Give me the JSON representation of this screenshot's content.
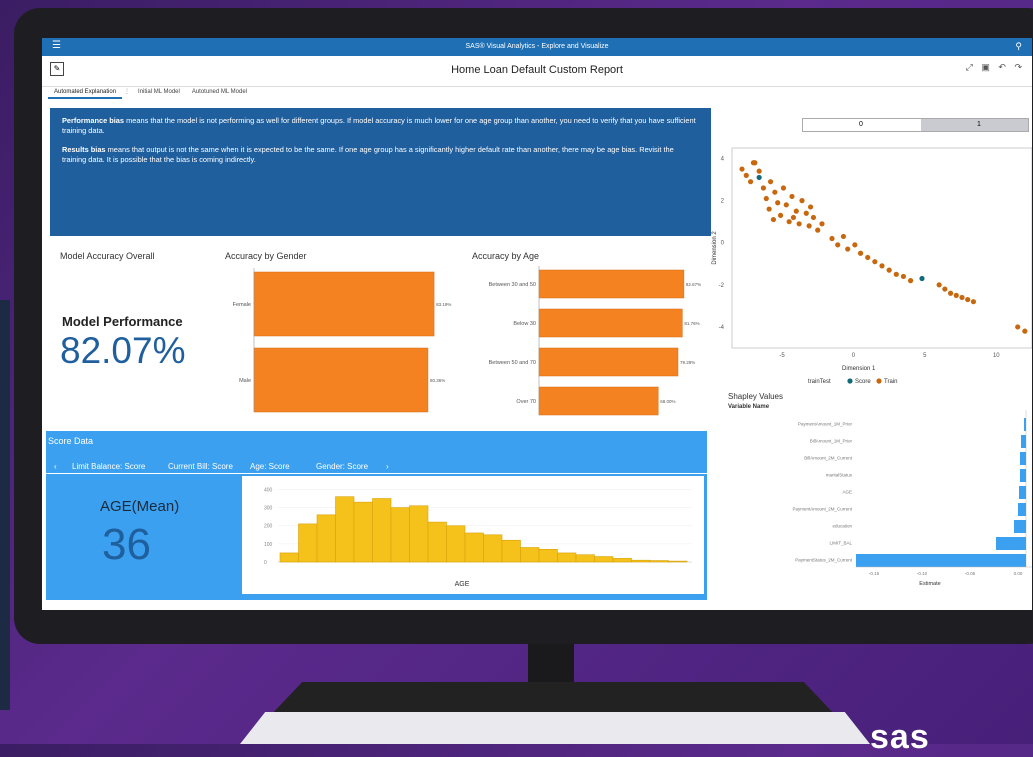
{
  "app": {
    "title": "SAS® Visual Analytics - Explore and Visualize"
  },
  "report": {
    "title": "Home Loan Default Custom Report"
  },
  "tabs": [
    "Automated Explanation",
    "Initial ML Model",
    "Autotuned ML Model"
  ],
  "explanation": {
    "p1_bold": "Performance bias",
    "p1_text": " means that the model is not performing as well for different groups. If model accuracy is much lower for one age group than another, you need to verify that you have sufficient training data.",
    "p2_bold": "Results bias",
    "p2_text": " means that output is not the same when it is expected to be the same.  If one age group has a significantly higher default rate than another, there may be age bias. Revisit the training data. It is possible that the bias is coming indirectly."
  },
  "overall": {
    "title": "Model Accuracy Overall",
    "label": "Model Performance",
    "value": "82.07%"
  },
  "gender_chart": {
    "title": "Accuracy by Gender",
    "categories": [
      "Female",
      "Male"
    ],
    "values": [
      83.19,
      80.36
    ],
    "labels": [
      "83.19%",
      "80.36%"
    ]
  },
  "age_chart": {
    "title": "Accuracy by Age",
    "categories": [
      "Between 30 and 50",
      "Below 30",
      "Between 50 and 70",
      "Over 70"
    ],
    "values": [
      82.67,
      81.76,
      79.28,
      68.0
    ],
    "labels": [
      "82.67%",
      "81.76%",
      "79.28%",
      "68.00%"
    ]
  },
  "score": {
    "header": "Score Data",
    "tabs": [
      "Limit Balance: Score",
      "Current Bill: Score",
      "Age: Score",
      "Gender: Score"
    ],
    "active_tab": 2,
    "age_label": "AGE(Mean)",
    "age_value": "36",
    "hist_xlabel": "AGE"
  },
  "toggle": {
    "left": "0",
    "right": "1"
  },
  "chart_data": [
    {
      "type": "bar",
      "title": "Accuracy by Gender",
      "categories": [
        "Female",
        "Male"
      ],
      "values": [
        83.19,
        80.36
      ]
    },
    {
      "type": "bar",
      "title": "Accuracy by Age",
      "categories": [
        "Between 30 and 50",
        "Below 30",
        "Between 50 and 70",
        "Over 70"
      ],
      "values": [
        82.67,
        81.76,
        79.28,
        68.0
      ]
    },
    {
      "type": "bar",
      "xlabel": "AGE",
      "yticks": [
        "400",
        "300",
        "200",
        "100",
        "0"
      ],
      "ylim": [
        0,
        430
      ],
      "bin_start": 21,
      "bin_width": 2,
      "values": [
        50,
        210,
        260,
        360,
        330,
        350,
        300,
        310,
        220,
        200,
        160,
        150,
        120,
        80,
        70,
        50,
        40,
        30,
        20,
        10,
        8,
        5
      ],
      "color": "#f5c21b"
    },
    {
      "type": "scatter",
      "xlabel": "Dimension 1",
      "ylabel": "Dimension 2",
      "xticks": [
        "-5",
        "0",
        "5",
        "10"
      ],
      "yticks": [
        "4",
        "2",
        "0",
        "-2",
        "-4"
      ],
      "xlim": [
        -8.5,
        12.5
      ],
      "ylim": [
        -5,
        4.5
      ],
      "legend": {
        "title": "trainTest",
        "items": [
          "Score",
          "Train"
        ]
      },
      "colors": {
        "Score": "#136b7a",
        "Train": "#c8680e"
      },
      "series": [
        {
          "name": "Train",
          "points": [
            [
              -7.5,
              3.2
            ],
            [
              -7.2,
              2.9
            ],
            [
              -7,
              3.8
            ],
            [
              -6.6,
              3.4
            ],
            [
              -6.3,
              2.6
            ],
            [
              -6.1,
              2.1
            ],
            [
              -5.9,
              1.6
            ],
            [
              -5.8,
              2.9
            ],
            [
              -5.5,
              2.4
            ],
            [
              -5.3,
              1.9
            ],
            [
              -5.1,
              1.3
            ],
            [
              -4.9,
              2.6
            ],
            [
              -4.7,
              1.8
            ],
            [
              -4.5,
              1.0
            ],
            [
              -4.3,
              2.2
            ],
            [
              -4.0,
              1.5
            ],
            [
              -3.8,
              0.9
            ],
            [
              -3.6,
              2.0
            ],
            [
              -3.3,
              1.4
            ],
            [
              -3.1,
              0.8
            ],
            [
              -2.8,
              1.2
            ],
            [
              -2.5,
              0.6
            ],
            [
              -2.2,
              0.9
            ],
            [
              -1.5,
              0.2
            ],
            [
              -1.1,
              -0.1
            ],
            [
              -0.7,
              0.3
            ],
            [
              -0.4,
              -0.3
            ],
            [
              0.1,
              -0.1
            ],
            [
              0.5,
              -0.5
            ],
            [
              1.0,
              -0.7
            ],
            [
              1.5,
              -0.9
            ],
            [
              2.0,
              -1.1
            ],
            [
              2.5,
              -1.3
            ],
            [
              3.0,
              -1.5
            ],
            [
              3.5,
              -1.6
            ],
            [
              4.0,
              -1.8
            ],
            [
              6.0,
              -2.0
            ],
            [
              6.4,
              -2.2
            ],
            [
              6.8,
              -2.4
            ],
            [
              7.2,
              -2.5
            ],
            [
              7.6,
              -2.6
            ],
            [
              8.0,
              -2.7
            ],
            [
              8.4,
              -2.8
            ],
            [
              11.5,
              -4.0
            ],
            [
              12.0,
              -4.2
            ],
            [
              -7.8,
              3.5
            ],
            [
              -6.9,
              3.8
            ],
            [
              -4.2,
              1.2
            ],
            [
              -3.0,
              1.7
            ],
            [
              -5.6,
              1.1
            ]
          ]
        },
        {
          "name": "Score",
          "points": [
            [
              -6.6,
              3.1
            ],
            [
              4.8,
              -1.7
            ]
          ]
        }
      ]
    },
    {
      "type": "bar",
      "title": "Shapley Values",
      "ylabel": "Variable Name",
      "xlabel": "Estimate",
      "categories": [
        "PaymentAmount_1M_Prior",
        "BillAmount_1M_Prior",
        "BillAmount_2M_Current",
        "maritalStatus",
        "AGE",
        "PaymentAmount_2M_Current",
        "education",
        "LIMIT_BAL",
        "PaymentStatus_2M_Current"
      ],
      "values": [
        -0.002,
        -0.005,
        -0.006,
        -0.006,
        -0.007,
        -0.008,
        -0.012,
        -0.03,
        -0.17
      ],
      "xticks": [
        "-0.15",
        "-0.10",
        "-0.05",
        "0.00"
      ],
      "color": "#3ba0f0"
    }
  ]
}
